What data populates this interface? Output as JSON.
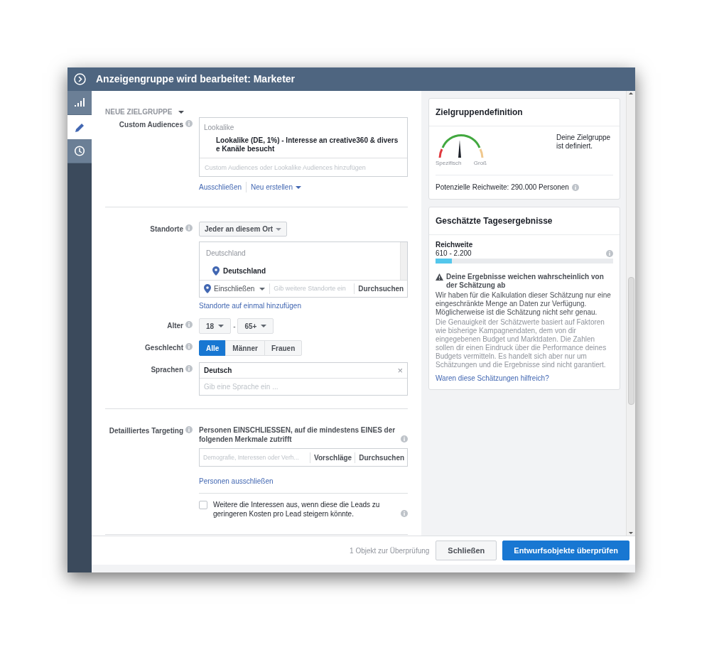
{
  "window": {
    "title": "Anzeigengruppe wird bearbeitet: Marketer"
  },
  "rail": [
    {
      "kind": "stats",
      "selected": false
    },
    {
      "kind": "edit",
      "selected": true
    },
    {
      "kind": "history",
      "selected": false
    }
  ],
  "section_header": "NEUE ZIELGRUPPE",
  "custom_audiences": {
    "label": "Custom Audiences",
    "group_heading": "Lookalike",
    "item_lines": [
      "Lookalike (DE, 1%) - Interesse an creative360 & divers",
      "e Kanäle besucht"
    ],
    "placeholder": "Custom Audiences oder Lookalike Audiences hinzufügen",
    "links": [
      "Ausschließen",
      "Neu erstellen"
    ]
  },
  "locations": {
    "label": "Standorte",
    "mode": "Jeder an diesem Ort",
    "group_heading": "Deutschland",
    "item": "Deutschland",
    "include": "Einschließen",
    "placeholder": "Gib weitere Standorte ein",
    "search": "Durchsuchen",
    "link": "Standorte auf einmal hinzufügen"
  },
  "age": {
    "label": "Alter",
    "from": "18",
    "separator": "-",
    "to": "65+"
  },
  "gender": {
    "label": "Geschlecht",
    "options": [
      {
        "label": "Alle",
        "selected": true
      },
      {
        "label": "Männer",
        "selected": false
      },
      {
        "label": "Frauen",
        "selected": false
      }
    ]
  },
  "languages": {
    "label": "Sprachen",
    "value": "Deutsch",
    "remove": "×",
    "placeholder": "Gib eine Sprache ein ..."
  },
  "detailed_targeting": {
    "label": "Detailliertes Targeting",
    "description": "Personen EINSCHLIESSEN, auf die mindestens EINES der folgenden Merkmale zutrifft",
    "placeholder": "Demografie, Interessen oder Verh...",
    "buttons": [
      "Vorschläge",
      "Durchsuchen"
    ],
    "link": "Personen ausschließen",
    "expansion": {
      "label": "Weitere die Interessen aus, wenn diese die Leads zu geringeren Kosten pro Lead steigern könnte.",
      "checked": false
    }
  },
  "audience_card": {
    "title": "Zielgruppendefinition",
    "gauge_min": "Spezifisch",
    "gauge_max": "Groß",
    "status": "Deine Zielgruppe ist definiert.",
    "reach": "Potenzielle Reichweite: 290.000 Personen"
  },
  "estimate_card": {
    "title": "Geschätzte Tagesergebnisse",
    "metric": "Reichweite",
    "value": "610 - 2.200",
    "level": 0.09,
    "warning_title": "Deine Ergebnisse weichen wahrscheinlich von der Schätzung ab",
    "warning_text": "Wir haben für die Kalkulation dieser Schätzung nur eine eingeschränkte Menge an Daten zur Verfügung. Möglicherweise ist die Schätzung nicht sehr genau.",
    "note": "Die Genauigkeit der Schätzwerte basiert auf Faktoren wie bisherige Kampagnendaten, dem von dir eingegebenen Budget und Marktdaten. Die Zahlen sollen dir einen Eindruck über die Performance deines Budgets vermitteln. Es handelt sich aber nur um Schätzungen und die Ergebnisse sind nicht garantiert.",
    "feedback_link": "Waren diese Schätzungen hilfreich?"
  },
  "footer": {
    "status": "1 Objekt zur Überprüfung",
    "buttons": [
      {
        "label": "Schließen",
        "kind": "secondary"
      },
      {
        "label": "Entwurfsobjekte überprüfen",
        "kind": "primary"
      }
    ]
  }
}
